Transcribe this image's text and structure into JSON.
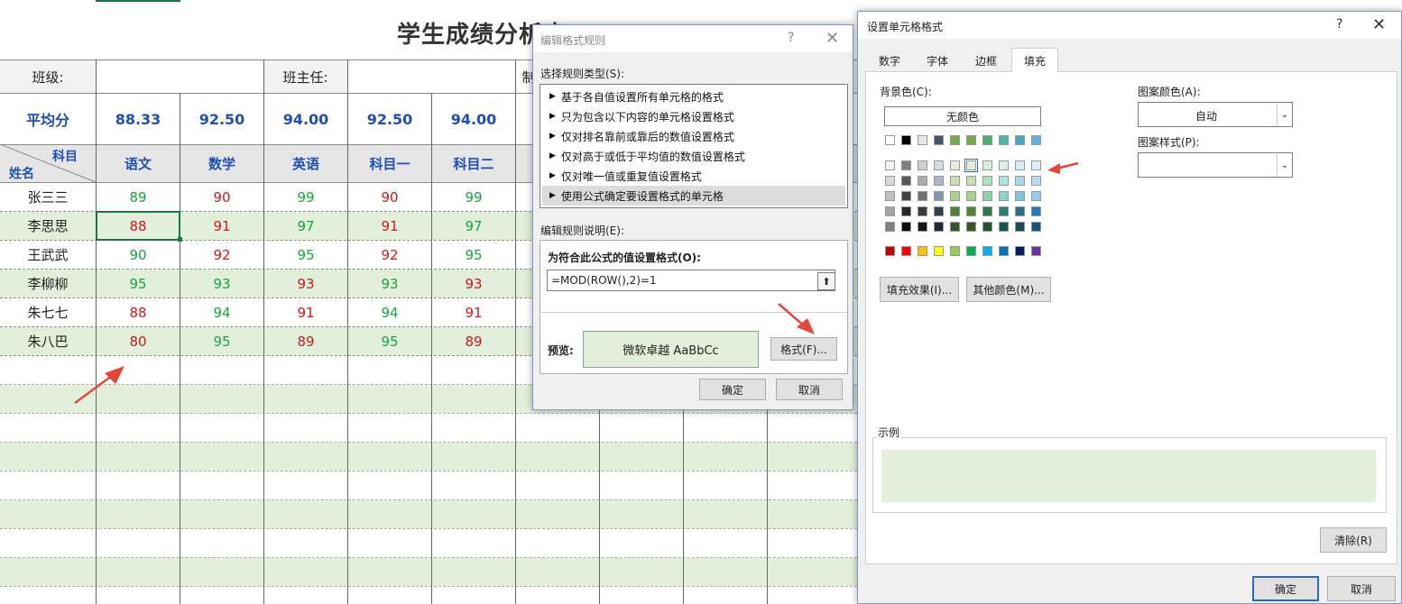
{
  "sheet": {
    "title": "学生成绩分析表",
    "class_label": "班级:",
    "teacher_label": "班主任:",
    "maker_label": "制",
    "avg_label": "平均分",
    "avgs": [
      "88.33",
      "92.50",
      "94.00",
      "92.50",
      "94.00"
    ],
    "header_subject": "科目",
    "header_name": "姓名",
    "headers": [
      "语文",
      "数学",
      "英语",
      "科目一",
      "科目二"
    ],
    "rows": [
      {
        "name": "张三三",
        "scores": [
          "89",
          "90",
          "99",
          "90",
          "99"
        ]
      },
      {
        "name": "李思思",
        "scores": [
          "88",
          "91",
          "97",
          "91",
          "97"
        ]
      },
      {
        "name": "王武武",
        "scores": [
          "90",
          "92",
          "95",
          "92",
          "95"
        ]
      },
      {
        "name": "李柳柳",
        "scores": [
          "95",
          "93",
          "93",
          "93",
          "93"
        ]
      },
      {
        "name": "朱七七",
        "scores": [
          "88",
          "94",
          "91",
          "94",
          "91"
        ]
      },
      {
        "name": "朱八巴",
        "scores": [
          "80",
          "95",
          "89",
          "95",
          "89"
        ]
      }
    ],
    "colors": {
      "band": "#e2efda",
      "green": "#17a43b",
      "red": "#d01818",
      "blue": "#1f4fb5"
    }
  },
  "rule_dialog": {
    "title": "编辑格式规则",
    "select_type_label": "选择规则类型(S):",
    "rule_types": [
      "基于各自值设置所有单元格的格式",
      "只为包含以下内容的单元格设置格式",
      "仅对排名靠前或靠后的数值设置格式",
      "仅对高于或低于平均值的数值设置格式",
      "仅对唯一值或重复值设置格式",
      "使用公式确定要设置格式的单元格"
    ],
    "edit_desc_label": "编辑规则说明(E):",
    "formula_label": "为符合此公式的值设置格式(O):",
    "formula_value": "=MOD(ROW(),2)=1",
    "preview_label": "预览:",
    "preview_text": "微软卓越  AaBbCc",
    "format_button": "格式(F)...",
    "ok_button": "确定",
    "cancel_button": "取消",
    "help": "?",
    "close": "✕"
  },
  "format_dialog": {
    "title": "设置单元格格式",
    "tabs": [
      "数字",
      "字体",
      "边框",
      "填充"
    ],
    "active_tab": "填充",
    "bg_color_label": "背景色(C):",
    "no_color": "无颜色",
    "pattern_color_label": "图案颜色(A):",
    "pattern_color_value": "自动",
    "pattern_style_label": "图案样式(P):",
    "fill_effects_button": "填充效果(I)...",
    "more_colors_button": "其他颜色(M)...",
    "sample_label": "示例",
    "clear_button": "清除(R)",
    "ok_button": "确定",
    "cancel_button": "取消",
    "help": "?",
    "close": "✕",
    "sample_color": "#e2efda",
    "theme_top": [
      "#ffffff",
      "#000000",
      "#e7e6e6",
      "#44546a",
      "#70ad47",
      "#70ad47",
      "#4cae6c",
      "#47b8a8",
      "#3fa9c8",
      "#5ab4e2"
    ],
    "theme_cols": [
      [
        "#f2f2f2",
        "#d9d9d9",
        "#bfbfbf",
        "#a6a6a6",
        "#808080"
      ],
      [
        "#808080",
        "#595959",
        "#404040",
        "#262626",
        "#0d0d0d"
      ],
      [
        "#d0cece",
        "#aeaaaa",
        "#767171",
        "#3a3838",
        "#171616"
      ],
      [
        "#d6dce4",
        "#adb9ca",
        "#8497b0",
        "#333f4f",
        "#222a35"
      ],
      [
        "#e2efda",
        "#c6e0b4",
        "#a9d08e",
        "#548235",
        "#375623"
      ],
      [
        "#e2efda",
        "#c6e0b4",
        "#a9d08e",
        "#548235",
        "#375623"
      ],
      [
        "#d9f0e0",
        "#b4e0c2",
        "#8fd1a3",
        "#2e7a48",
        "#1e5130"
      ],
      [
        "#d8f1ee",
        "#b1e3dc",
        "#8ad5cb",
        "#2a7d72",
        "#1c534c"
      ],
      [
        "#d4ecf4",
        "#a9d9e9",
        "#7fc6de",
        "#256f88",
        "#184a5a"
      ],
      [
        "#dcedf9",
        "#b9dcf3",
        "#96cbed",
        "#1f7dbd",
        "#15537e"
      ]
    ],
    "standard": [
      "#c00000",
      "#ff0000",
      "#ffc000",
      "#ffff00",
      "#92d050",
      "#00b050",
      "#00b0f0",
      "#0070c0",
      "#002060",
      "#7030a0"
    ]
  }
}
